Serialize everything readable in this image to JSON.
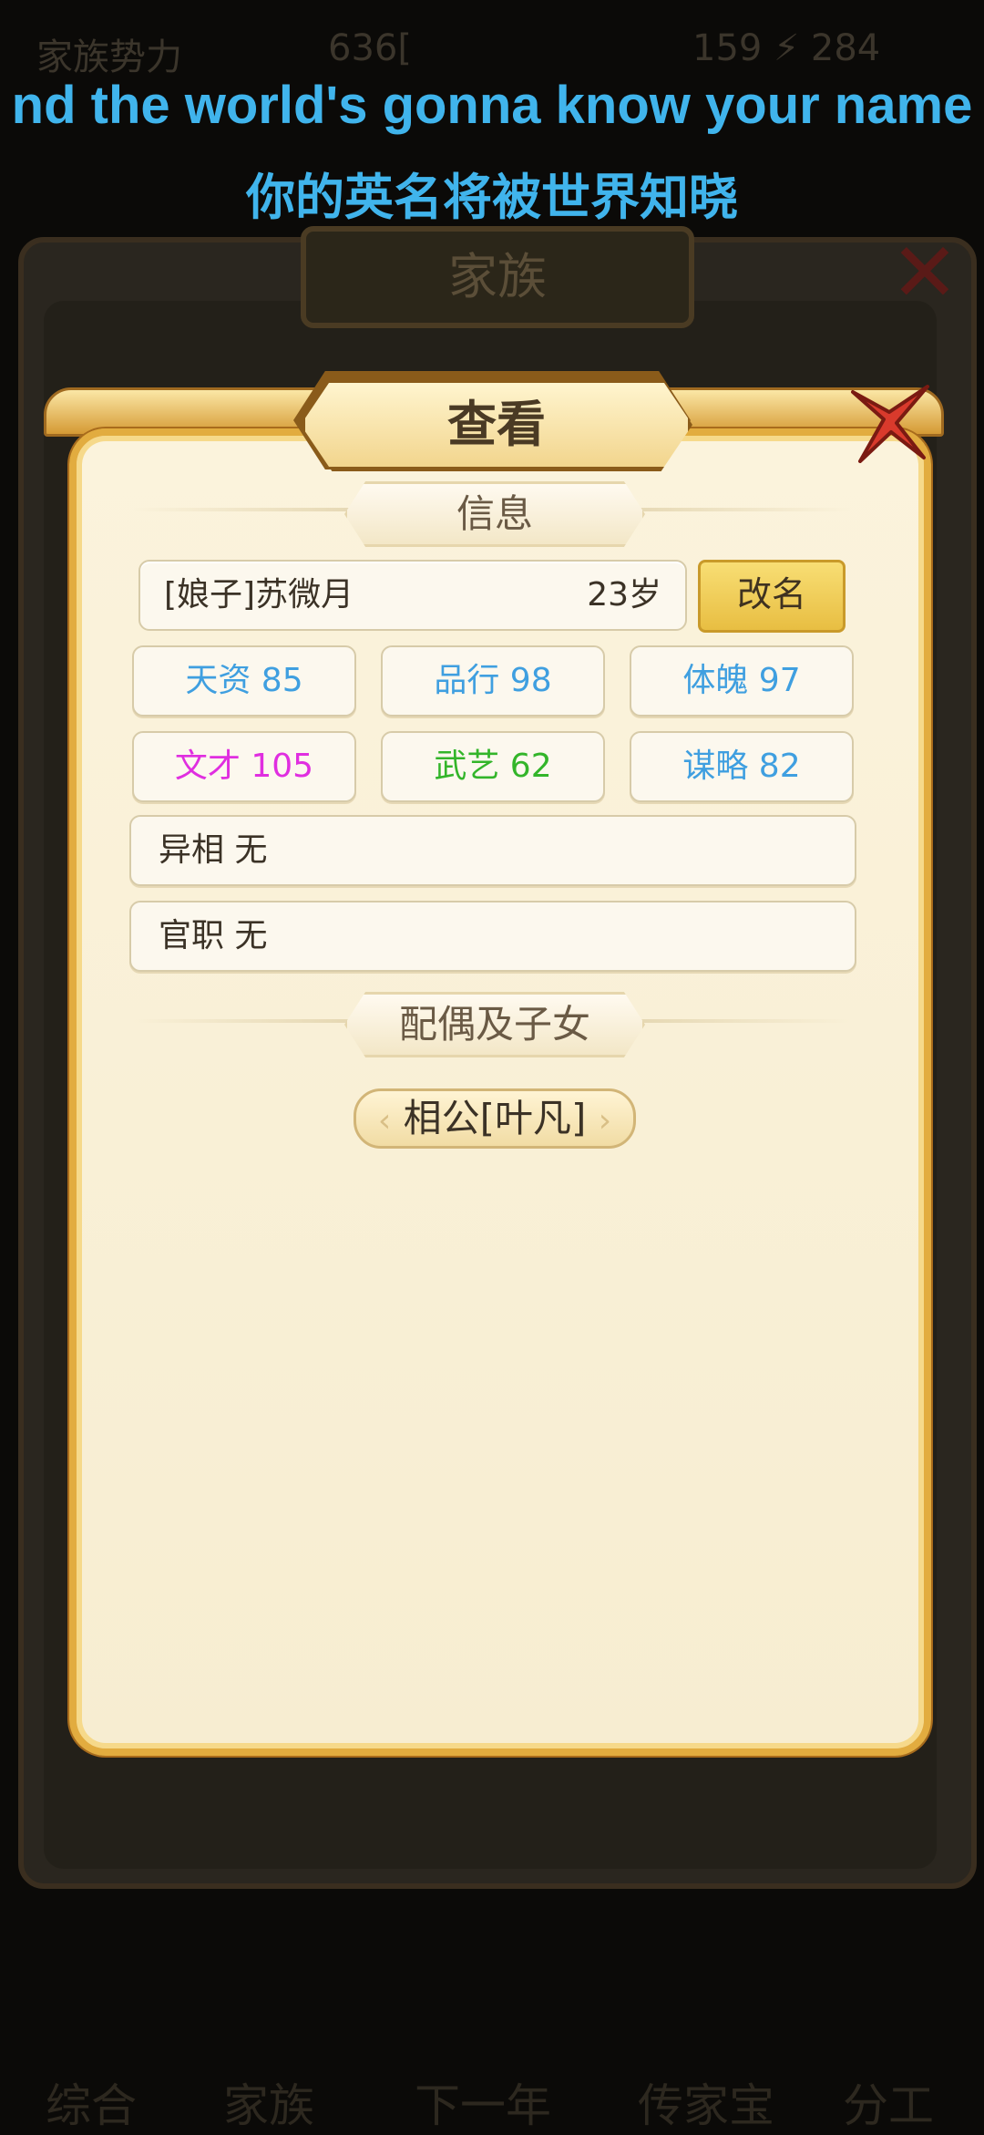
{
  "background": {
    "status_left": "家族势力",
    "status_mid": "636[",
    "status_right": "159 ⚡ 284",
    "family_title": "家族",
    "nav": [
      "综合",
      "家族",
      "下一年",
      "传家宝",
      "分工"
    ]
  },
  "lyrics": {
    "english": "nd the world's gonna know your name",
    "chinese": "你的英名将被世界知晓"
  },
  "dialog": {
    "title": "查看",
    "info_section": "信息",
    "person_name": "[娘子]苏微月",
    "person_age": "23岁",
    "rename_label": "改名",
    "stats": [
      {
        "label": "天资 85",
        "color": "#3f9fe0"
      },
      {
        "label": "品行 98",
        "color": "#3f9fe0"
      },
      {
        "label": "体魄 97",
        "color": "#3f9fe0"
      },
      {
        "label": "文才 105",
        "color": "#e02ee0"
      },
      {
        "label": "武艺 62",
        "color": "#33b52a"
      },
      {
        "label": "谋略 82",
        "color": "#3f9fe0"
      }
    ],
    "trait_label": "异相 无",
    "office_label": "官职 无",
    "family_section": "配偶及子女",
    "spouse_label": "相公[叶凡]"
  },
  "icons": {
    "close": "close-x-icon"
  }
}
